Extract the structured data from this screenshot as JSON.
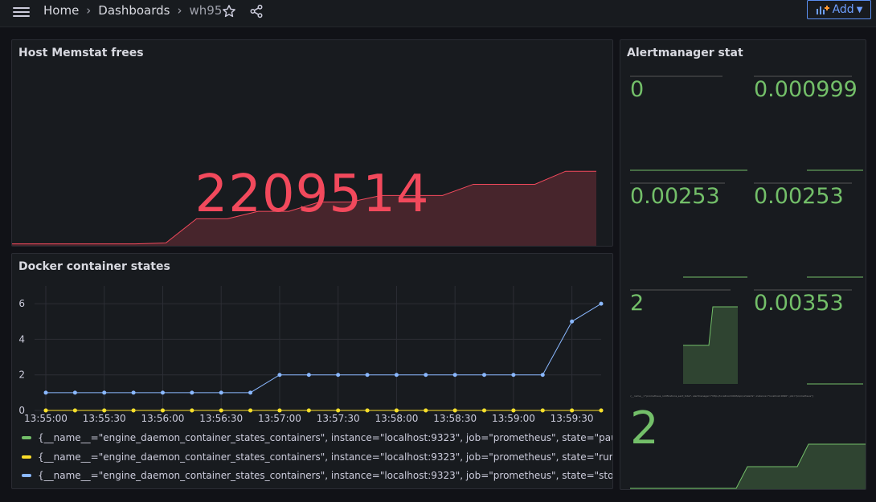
{
  "nav": {
    "breadcrumbs": [
      "Home",
      "Dashboards",
      "wh95"
    ],
    "add_label": "Add"
  },
  "panels": {
    "memstat": {
      "title": "Host Memstat frees",
      "value": "2209514",
      "color": "#f2495c",
      "sparkline": [
        2,
        2,
        2,
        2,
        2,
        3,
        29,
        29,
        37,
        37,
        47,
        47,
        54,
        54,
        54,
        66,
        66,
        66,
        80,
        80
      ]
    },
    "docker": {
      "title": "Docker container states",
      "legend": [
        {
          "label": "{__name__=\"engine_daemon_container_states_containers\", instance=\"localhost:9323\", job=\"prometheus\", state=\"paused\"}",
          "color": "#73bf69"
        },
        {
          "label": "{__name__=\"engine_daemon_container_states_containers\", instance=\"localhost:9323\", job=\"prometheus\", state=\"running\"}",
          "color": "#fade2a"
        },
        {
          "label": "{__name__=\"engine_daemon_container_states_containers\", instance=\"localhost:9323\", job=\"prometheus\", state=\"stopped\"}",
          "color": "#8ab8ff"
        }
      ]
    },
    "alertmanager": {
      "title": "Alertmanager stat",
      "stats": [
        {
          "value": "0"
        },
        {
          "value": "0.000999"
        },
        {
          "value": "0.00253"
        },
        {
          "value": "0.00253"
        },
        {
          "value": "2"
        },
        {
          "value": "0.00353"
        },
        {
          "value": "2",
          "caption": "{__name__=\"prometheus_notifications_sent_total\", alertmanager=\"http://localhost:9093/api/v2/alerts\", instance=\"localhost:9090\", job=\"prometheus\"}"
        }
      ],
      "color": "#73bf69"
    }
  },
  "chart_data": {
    "type": "line",
    "title": "Docker container states",
    "x": [
      "13:55:00",
      "13:55:15",
      "13:55:30",
      "13:55:45",
      "13:56:00",
      "13:56:15",
      "13:56:30",
      "13:56:45",
      "13:57:00",
      "13:57:15",
      "13:57:30",
      "13:57:45",
      "13:58:00",
      "13:58:15",
      "13:58:30",
      "13:58:45",
      "13:59:00",
      "13:59:15",
      "13:59:30",
      "13:59:45"
    ],
    "x_tick_labels": [
      "13:55:00",
      "13:55:30",
      "13:56:00",
      "13:56:30",
      "13:57:00",
      "13:57:30",
      "13:58:00",
      "13:58:30",
      "13:59:00",
      "13:59:30"
    ],
    "y_ticks": [
      0,
      2,
      4,
      6
    ],
    "ylim": [
      0,
      7
    ],
    "grid": true,
    "legend_position": "bottom",
    "series": [
      {
        "name": "{__name__=\"engine_daemon_container_states_containers\", instance=\"localhost:9323\", job=\"prometheus\", state=\"paused\"}",
        "color": "#73bf69",
        "values": [
          0,
          0,
          0,
          0,
          0,
          0,
          0,
          0,
          0,
          0,
          0,
          0,
          0,
          0,
          0,
          0,
          0,
          0,
          0,
          0
        ]
      },
      {
        "name": "{__name__=\"engine_daemon_container_states_containers\", instance=\"localhost:9323\", job=\"prometheus\", state=\"running\"}",
        "color": "#fade2a",
        "values": [
          0,
          0,
          0,
          0,
          0,
          0,
          0,
          0,
          0,
          0,
          0,
          0,
          0,
          0,
          0,
          0,
          0,
          0,
          0,
          0
        ]
      },
      {
        "name": "{__name__=\"engine_daemon_container_states_containers\", instance=\"localhost:9323\", job=\"prometheus\", state=\"stopped\"}",
        "color": "#8ab8ff",
        "values": [
          1,
          1,
          1,
          1,
          1,
          1,
          1,
          1,
          2,
          2,
          2,
          2,
          2,
          2,
          2,
          2,
          2,
          2,
          5,
          6
        ]
      }
    ]
  }
}
